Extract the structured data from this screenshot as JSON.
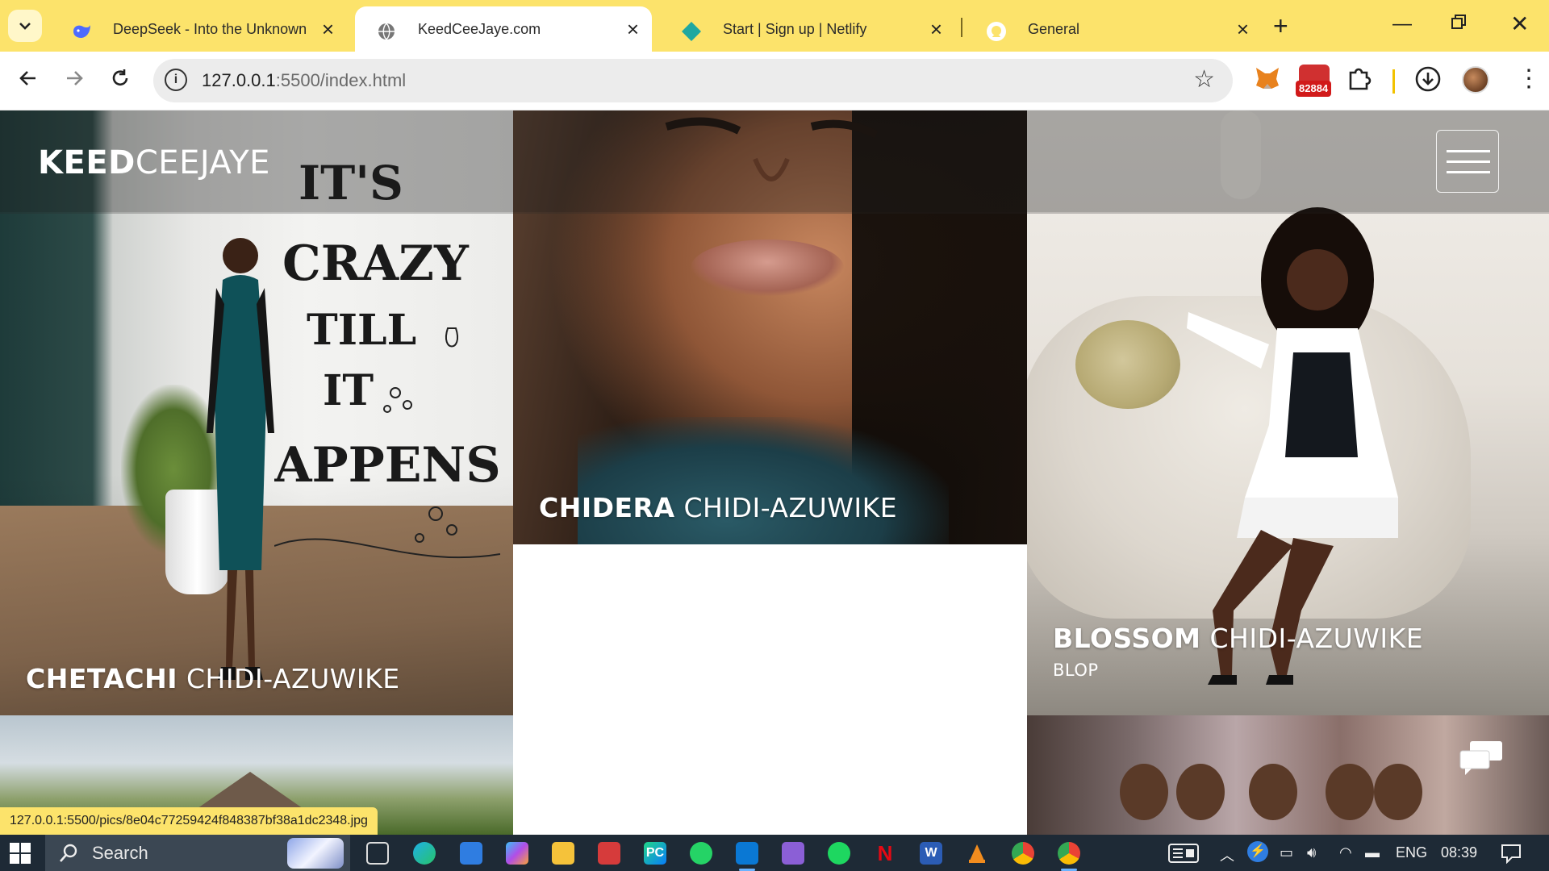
{
  "browser": {
    "tabs": [
      {
        "title": "DeepSeek - Into the Unknown",
        "icon": "deepseek-whale-icon",
        "active": false
      },
      {
        "title": "KeedCeeJaye.com",
        "icon": "globe-icon",
        "active": true
      },
      {
        "title": "Start | Sign up | Netlify",
        "icon": "netlify-icon",
        "active": false
      },
      {
        "title": "General",
        "icon": "github-icon",
        "active": false
      }
    ],
    "url_host": "127.0.0.1",
    "url_path": ":5500/index.html",
    "extension_badge": "82884",
    "status_link": "127.0.0.1:5500/pics/8e04c77259424f848387bf38a1dc2348.jpg"
  },
  "site": {
    "logo_bold": "KEED",
    "logo_light": "CEEJAYE",
    "cards": [
      {
        "first": "CHETACHI",
        "last": "CHIDI-AZUWIKE",
        "subtitle": ""
      },
      {
        "first": "CHIDERA",
        "last": "CHIDI-AZUWIKE",
        "subtitle": ""
      },
      {
        "first": "BLOSSOM",
        "last": "CHIDI-AZUWIKE",
        "subtitle": "BLOP"
      }
    ]
  },
  "taskbar": {
    "search_label": "Search",
    "language": "ENG",
    "time": "08:39",
    "apps": [
      "task-view-icon",
      "edge-icon",
      "store-icon",
      "copilot-icon",
      "file-explorer-icon",
      "ms-app-icon",
      "pycharm-icon",
      "whatsapp-icon",
      "vscode-icon",
      "visual-studio-icon",
      "spotify-icon",
      "netflix-icon",
      "word-icon",
      "vlc-icon",
      "chrome-icon",
      "chrome-active-icon"
    ]
  },
  "colors": {
    "tabstrip": "#fce36b",
    "taskbar": "#1e2a36",
    "overlay_header": "rgba(30,30,30,0.35)"
  }
}
